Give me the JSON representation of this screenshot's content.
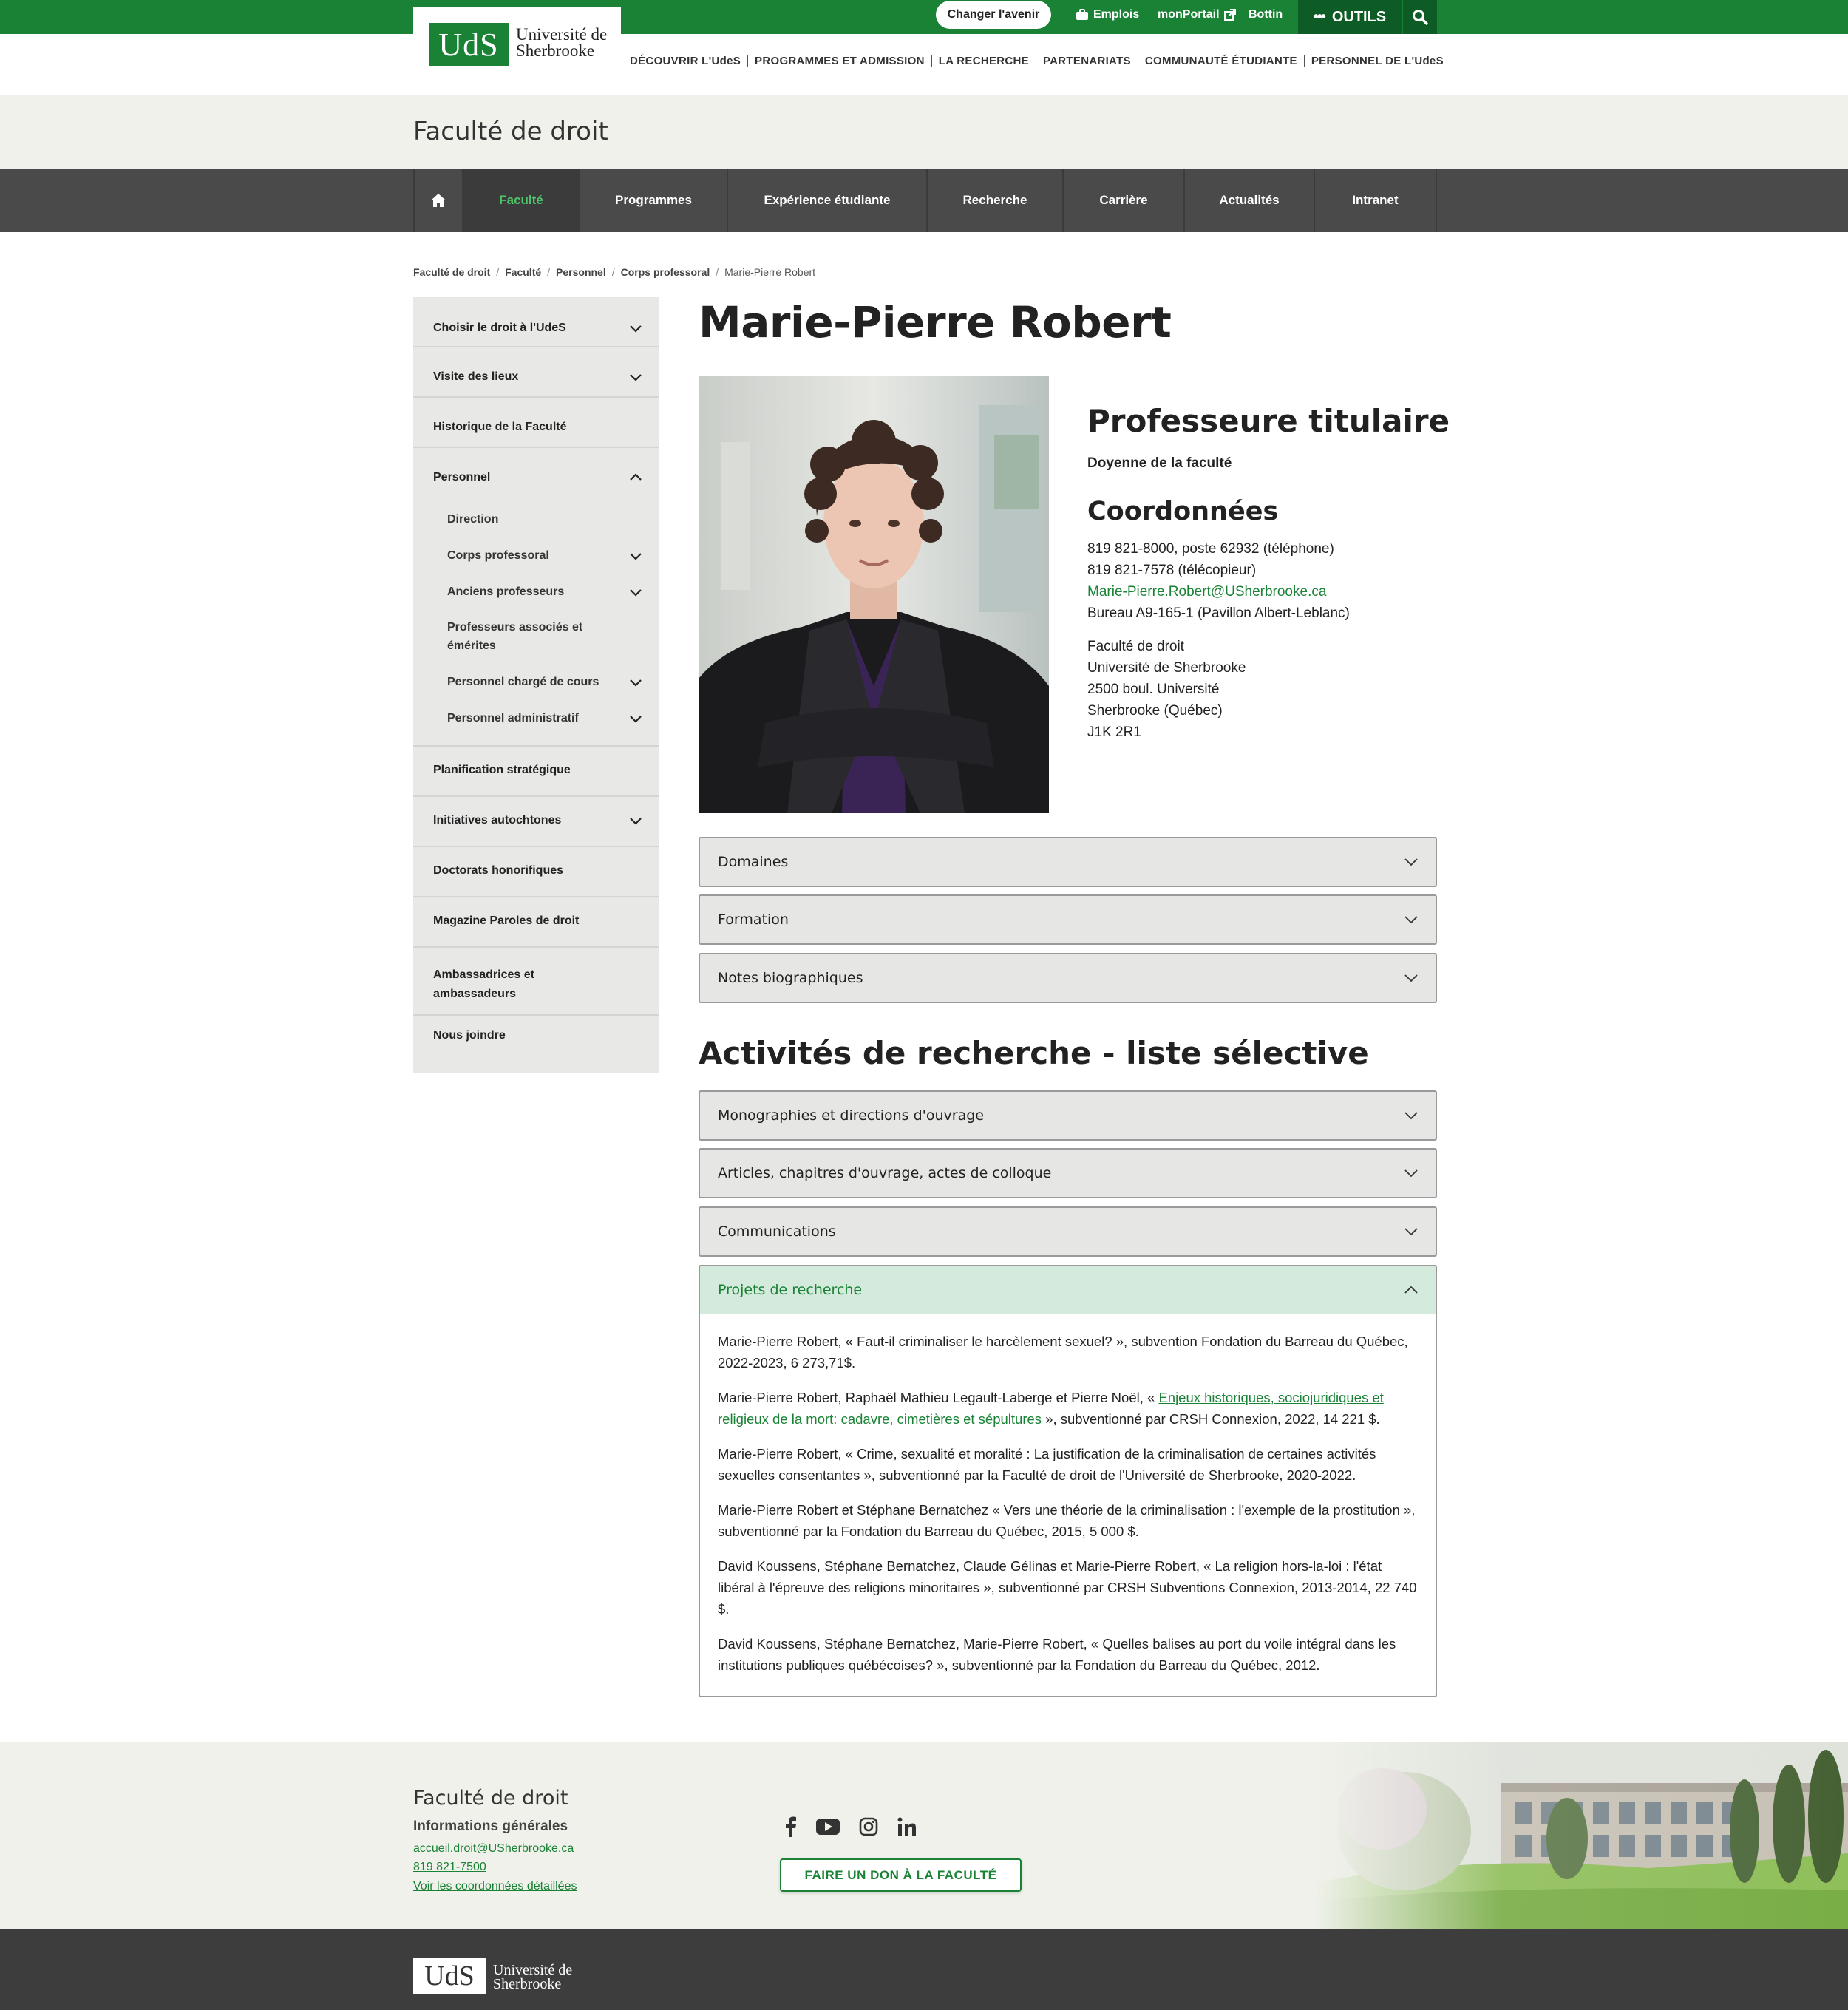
{
  "topbar": {
    "avenir_label": "Changer l'avenir",
    "links": [
      {
        "label": "Emplois",
        "icon": "briefcase-icon"
      },
      {
        "label": "monPortail",
        "icon": "external-link-icon"
      },
      {
        "label": "Bottin"
      }
    ],
    "outils_label": "OUTILS",
    "search_icon": "search-icon"
  },
  "logo": {
    "mark": "UdS",
    "line1": "Université de",
    "line2": "Sherbrooke"
  },
  "mainnav": [
    "DÉCOUVRIR L'UdeS",
    "PROGRAMMES ET ADMISSION",
    "LA RECHERCHE",
    "PARTENARIATS",
    "COMMUNAUTÉ ÉTUDIANTE",
    "PERSONNEL DE L'UdeS"
  ],
  "faculty": {
    "title": "Faculté de droit"
  },
  "facnav": [
    "Faculté",
    "Programmes",
    "Expérience étudiante",
    "Recherche",
    "Carrière",
    "Actualités",
    "Intranet"
  ],
  "breadcrumb": [
    "Faculté de droit",
    "Faculté",
    "Personnel",
    "Corps professoral",
    "Marie-Pierre Robert"
  ],
  "sidebar": {
    "items": [
      "Choisir le droit à l'UdeS",
      "Visite des lieux",
      "Historique de la Faculté",
      "Personnel",
      "Planification stratégique",
      "Initiatives autochtones",
      "Doctorats honorifiques",
      "Magazine Paroles de droit",
      "Ambassadrices et ambassadeurs",
      "Nous joindre"
    ],
    "personnel_sub": [
      "Direction",
      "Corps professoral",
      "Anciens professeurs",
      "Professeurs associés et émérites",
      "Personnel chargé de cours",
      "Personnel administratif"
    ]
  },
  "person": {
    "name": "Marie-Pierre Robert",
    "title": "Professeure titulaire",
    "subtitle": "Doyenne de la faculté",
    "coord_title": "Coordonnées",
    "phone": "819 821-8000, poste 62932 (téléphone)",
    "fax": "819 821-7578 (télécopieur)",
    "email": "Marie-Pierre.Robert@USherbrooke.ca",
    "office": "Bureau A9-165-1 (Pavillon Albert-Leblanc)",
    "address": [
      "Faculté de droit",
      "Université de Sherbrooke",
      "2500 boul. Université",
      "Sherbrooke (Québec)",
      "J1K 2R1"
    ]
  },
  "accordions_top": [
    "Domaines",
    "Formation",
    "Notes biographiques"
  ],
  "research": {
    "title": "Activités de recherche - liste sélective",
    "accordions": [
      "Monographies et directions d'ouvrage",
      "Articles, chapitres d'ouvrage, actes de colloque",
      "Communications",
      "Projets de recherche"
    ],
    "projects": {
      "p1": "Marie-Pierre Robert, « Faut-il criminaliser le harcèlement sexuel? », subvention Fondation du Barreau du Québec, 2022-2023, 6 273,71$.",
      "p2_pre": "Marie-Pierre Robert, Raphaël Mathieu Legault-Laberge et Pierre Noël, « ",
      "p2_link": "Enjeux historiques, sociojuridiques et religieux de la mort: cadavre, cimetières et sépultures",
      "p2_post": " », subventionné par CRSH Connexion, 2022, 14 221 $.",
      "p3": "Marie-Pierre Robert, « Crime, sexualité et moralité : La justification de la criminalisation de certaines activités sexuelles consentantes », subventionné par la Faculté de droit de l'Université de Sherbrooke, 2020-2022.",
      "p4": "Marie-Pierre Robert et Stéphane Bernatchez « Vers une théorie de la criminalisation : l'exemple de la prostitution », subventionné par la Fondation du Barreau du Québec, 2015, 5 000 $.",
      "p5": "David Koussens, Stéphane Bernatchez, Claude Gélinas et Marie-Pierre Robert, « La religion hors-la-loi : l'état libéral à l'épreuve des religions minoritaires », subventionné par CRSH Subventions Connexion, 2013-2014, 22 740 $.",
      "p6": "David Koussens, Stéphane Bernatchez, Marie-Pierre Robert, « Quelles balises au port du voile intégral dans les institutions publiques québécoises? », subventionné par la Fondation du Barreau du Québec, 2012."
    }
  },
  "footer": {
    "title": "Faculté de droit",
    "subtitle": "Informations générales",
    "email": "accueil.droit@USherbrooke.ca",
    "phone": "819 821-7500",
    "details": "Voir les coordonnées détaillées",
    "socials": [
      "facebook-icon",
      "youtube-icon",
      "instagram-icon",
      "linkedin-icon"
    ],
    "don_label": "FAIRE UN DON À LA FACULTÉ"
  },
  "colors": {
    "brand_green": "#198235",
    "dark_green": "#0d5c26",
    "dark_gray": "#4a4a4a",
    "light_band": "#eff1ea"
  }
}
